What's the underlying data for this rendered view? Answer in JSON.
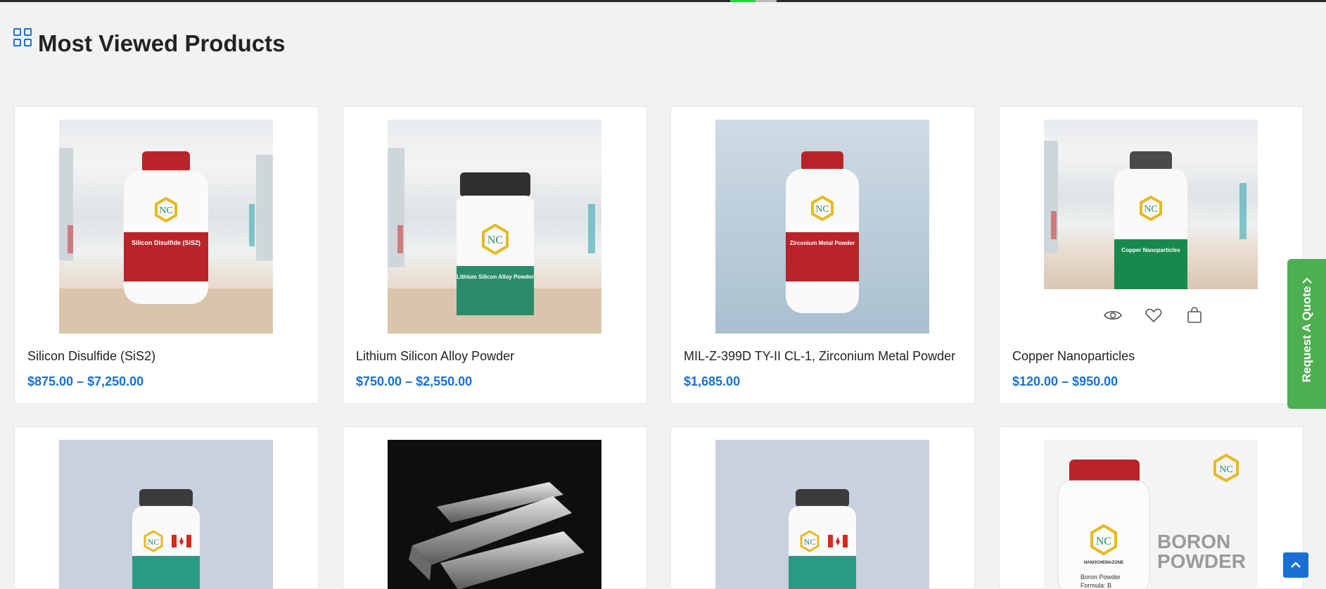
{
  "section": {
    "title": "Most Viewed Products",
    "icon": "grid-icon"
  },
  "products_row1": [
    {
      "name": "Silicon Disulfide (SiS2)",
      "price": "$875.00 – $7,250.00",
      "label": "Silicon Disulfide (SiS2)",
      "cap": "#b8242a",
      "band": "#b8242a"
    },
    {
      "name": "Lithium Silicon Alloy Powder",
      "price": "$750.00 – $2,550.00",
      "label": "Lithium Silicon Alloy Powder",
      "cap": "#2f2f2f",
      "band": "#2a8c6b"
    },
    {
      "name": "MIL-Z-399D TY-II CL-1, Zirconium Metal Powder",
      "price": "$1,685.00",
      "label": "Zirconium Metal Powder",
      "cap": "#b8242a",
      "band": "#b8242a"
    },
    {
      "name": "Copper Nanoparticles",
      "price": "$120.00 – $950.00",
      "label": "Copper Nanoparticles",
      "cap": "#4a4a4a",
      "band": "#168a4c"
    }
  ],
  "product_actions": {
    "view": "eye-icon",
    "wishlist": "heart-icon",
    "cart": "bag-icon"
  },
  "products_row2": [
    {
      "cap": "#3b3b3b",
      "band": "#2a9a84"
    },
    {
      "image": "metal-ingots"
    },
    {
      "cap": "#3b3b3b",
      "band": "#2a9a84"
    },
    {
      "label": "BORON POWDER",
      "sub1": "Boron Powder",
      "sub2": "Formula: B",
      "brand": "NANOCHEMAZONE",
      "cap": "#b8242a"
    }
  ],
  "brand_mark": "NC",
  "quote_tab": {
    "label": "Request A Quote"
  },
  "colors": {
    "accent": "#1a6fd4",
    "quote": "#4caf50"
  }
}
